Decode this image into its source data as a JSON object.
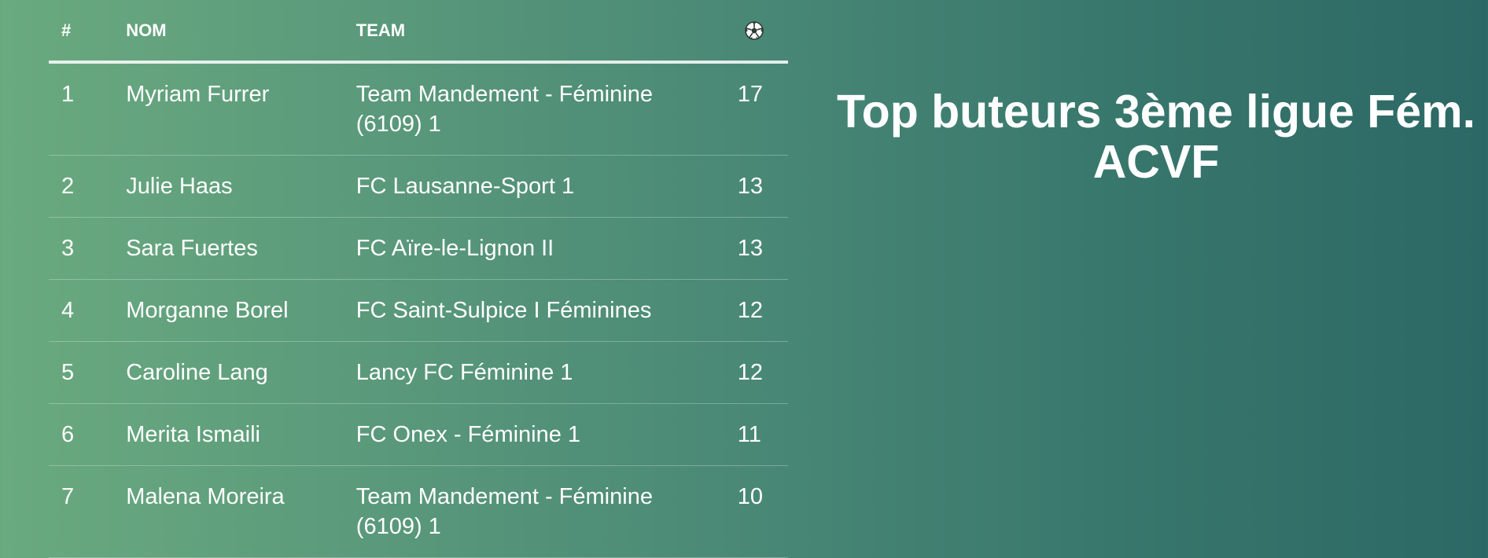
{
  "table": {
    "headers": {
      "rank": "#",
      "name": "NOM",
      "team": "TEAM",
      "goals_icon": "soccer-ball-icon"
    },
    "rows": [
      {
        "rank": "1",
        "name": "Myriam Furrer",
        "team": "Team Mandement - Féminine (6109) 1",
        "goals": "17"
      },
      {
        "rank": "2",
        "name": "Julie Haas",
        "team": "FC Lausanne-Sport 1",
        "goals": "13"
      },
      {
        "rank": "3",
        "name": "Sara Fuertes",
        "team": "FC Aïre-le-Lignon II",
        "goals": "13"
      },
      {
        "rank": "4",
        "name": "Morganne Borel",
        "team": "FC Saint-Sulpice I Féminines",
        "goals": "12"
      },
      {
        "rank": "5",
        "name": "Caroline Lang",
        "team": "Lancy FC Féminine 1",
        "goals": "12"
      },
      {
        "rank": "6",
        "name": "Merita Ismaili",
        "team": "FC Onex - Féminine 1",
        "goals": "11"
      },
      {
        "rank": "7",
        "name": "Malena Moreira",
        "team": "Team Mandement - Féminine (6109) 1",
        "goals": "10"
      }
    ]
  },
  "title": {
    "line1": "Top buteurs 3ème ligue Fém.",
    "line2": "ACVF"
  },
  "colors": {
    "gradient_start": "#6aaa7f",
    "gradient_end": "#2c6865",
    "text": "#ffffff"
  }
}
